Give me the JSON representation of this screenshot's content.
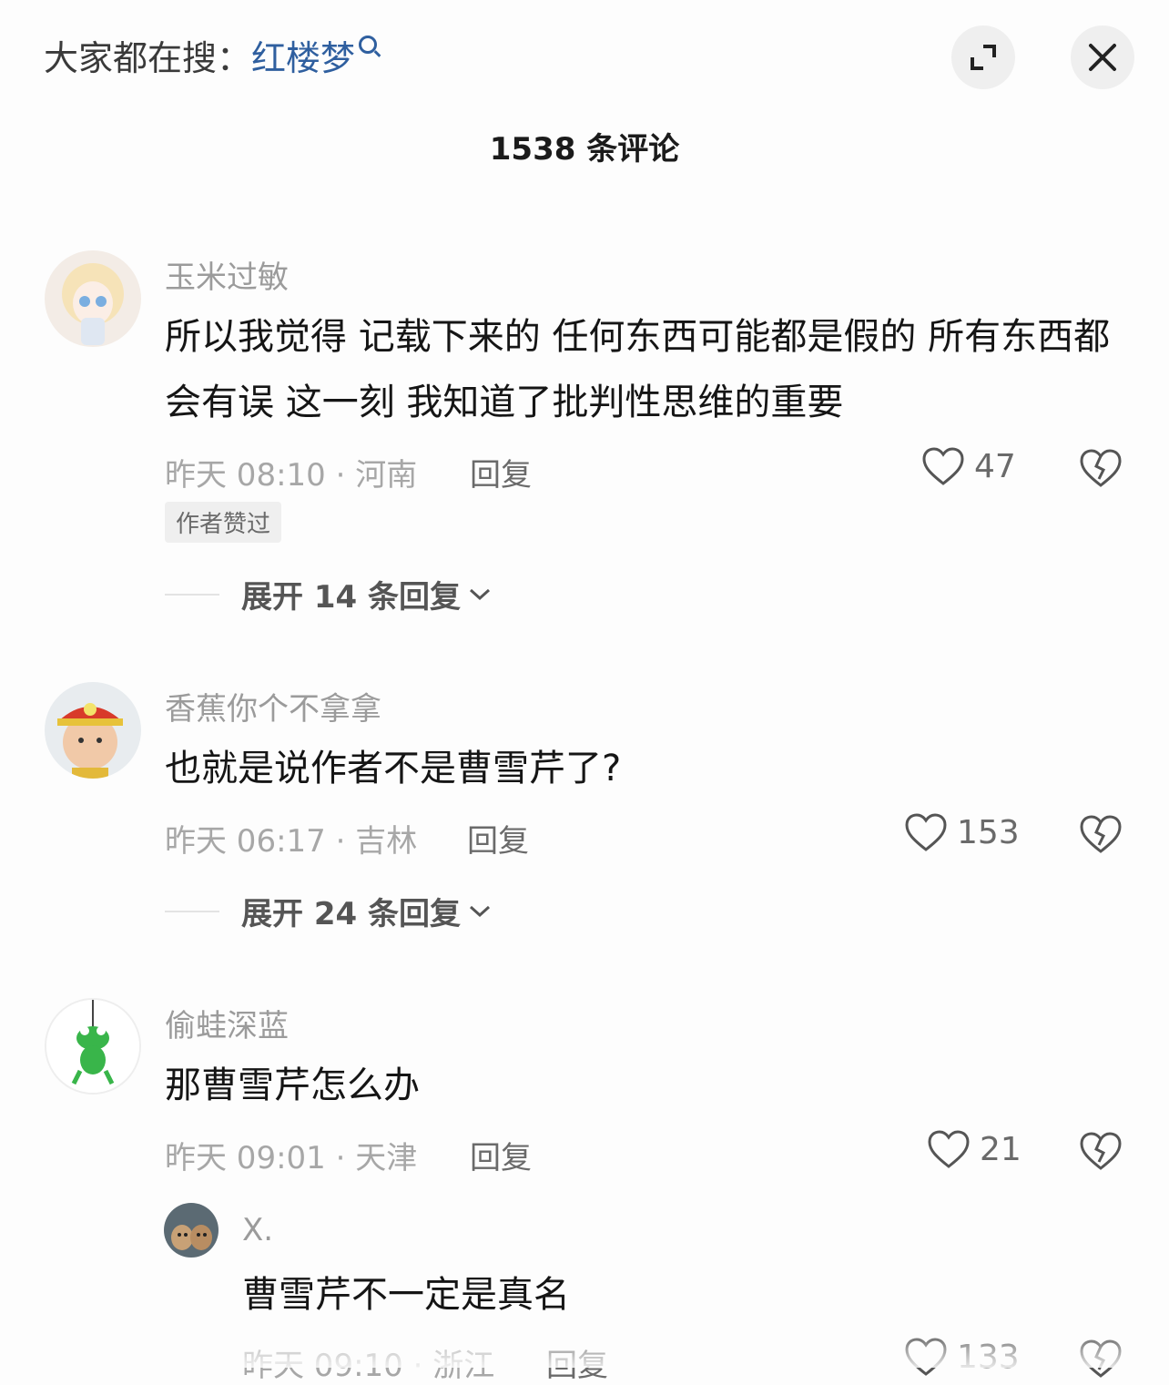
{
  "header": {
    "search_prefix": "大家都在搜：",
    "search_keyword": "红楼梦",
    "comment_count_title": "1538 条评论"
  },
  "labels": {
    "reply": "回复",
    "author_liked": "作者赞过"
  },
  "comments": [
    {
      "username": "玉米过敏",
      "text": "所以我觉得 记载下来的 任何东西可能都是假的 所有东西都会有误 这一刻 我知道了批判性思维的重要",
      "time_location": "昨天 08:10 · 河南",
      "likes": "47",
      "expand_replies": "展开 14 条回复"
    },
    {
      "username": "香蕉你个不拿拿",
      "text": "也就是说作者不是曹雪芹了?",
      "time_location": "昨天 06:17 · 吉林",
      "likes": "153",
      "expand_replies": "展开 24 条回复"
    },
    {
      "username": "偷蛙深蓝",
      "text": "那曹雪芹怎么办",
      "time_location": "昨天 09:01 · 天津",
      "likes": "21"
    }
  ],
  "sub_reply": {
    "username": "X.",
    "text": "曹雪芹不一定是真名",
    "time_location": "昨天 09:10 · 浙江",
    "likes": "133"
  },
  "icons": [
    "search-icon",
    "expand-icon",
    "close-icon",
    "heart-icon",
    "broken-heart-icon",
    "chevron-down-icon"
  ]
}
